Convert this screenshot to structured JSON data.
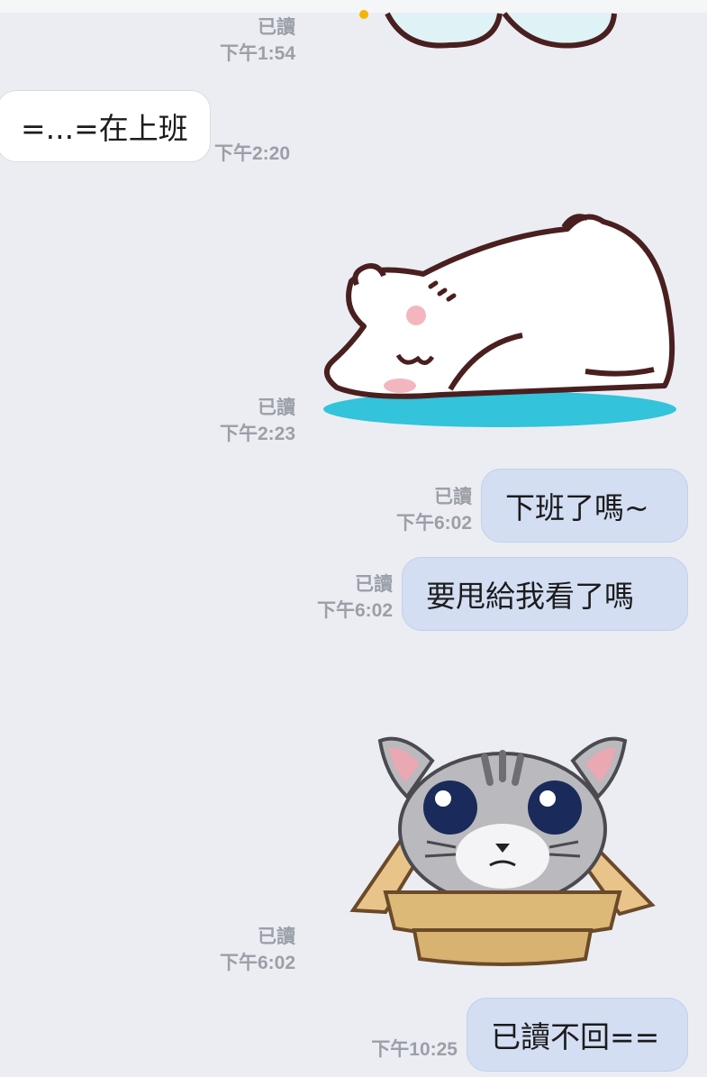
{
  "messages": [
    {
      "type": "sticker",
      "sender": "me",
      "sticker": "partial-sticker",
      "read_label": "已讀",
      "time": "下午1:54"
    },
    {
      "type": "text",
      "sender": "other",
      "text": "=...=在上班",
      "time": "下午2:20"
    },
    {
      "type": "sticker",
      "sender": "me",
      "sticker": "sleeping-polar-bear",
      "read_label": "已讀",
      "time": "下午2:23"
    },
    {
      "type": "text",
      "sender": "me",
      "text": "下班了嗎~",
      "read_label": "已讀",
      "time": "下午6:02"
    },
    {
      "type": "text",
      "sender": "me",
      "text": "要甩給我看了嗎",
      "read_label": "已讀",
      "time": "下午6:02"
    },
    {
      "type": "sticker",
      "sender": "me",
      "sticker": "cat-in-cardboard-box",
      "read_label": "已讀",
      "time": "下午6:02"
    },
    {
      "type": "text",
      "sender": "me",
      "text": "已讀不回==",
      "time": "下午10:25"
    }
  ],
  "colors": {
    "background": "#ebedf3",
    "outgoing_bubble": "#d3def3",
    "incoming_bubble": "#ffffff",
    "meta_text": "#9b9fa8"
  }
}
